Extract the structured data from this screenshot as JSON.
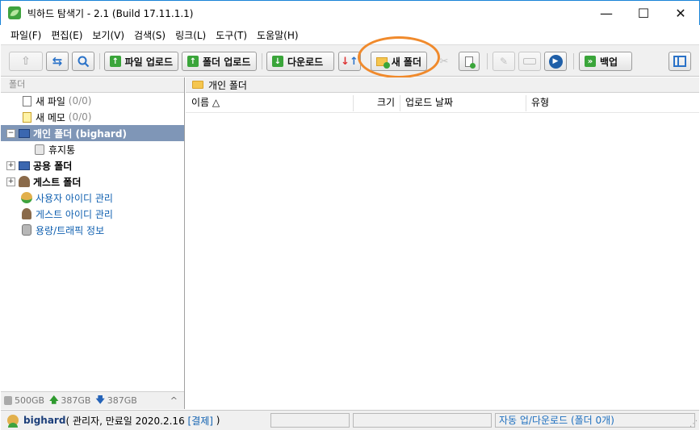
{
  "window": {
    "title": "빅하드 탐색기 - 2.1 (Build 17.11.1.1)",
    "min_glyph": "—",
    "max_glyph": "☐",
    "close_glyph": "✕"
  },
  "menu": [
    "파일(F)",
    "편집(E)",
    "보기(V)",
    "검색(S)",
    "링크(L)",
    "도구(T)",
    "도움말(H)"
  ],
  "toolbar": {
    "file_upload": "파일 업로드",
    "folder_upload": "폴더 업로드",
    "download": "다운로드",
    "new_folder": "새 폴더",
    "backup": "백업",
    "icons": [
      "up-arrow-icon",
      "refresh-icon",
      "search-icon",
      "upload-icon",
      "download-icon",
      "sync-icon",
      "new-folder-icon",
      "cut-icon",
      "new-file-icon",
      "rename-icon",
      "tag-icon",
      "play-icon",
      "backup-icon",
      "panel-toggle-icon"
    ]
  },
  "left_pane": {
    "header": "폴더",
    "tree": [
      {
        "label": "새 파일",
        "count": "(0/0)"
      },
      {
        "label": "새 메모",
        "count": "(0/0)"
      },
      {
        "label": "개인 폴더 (bighard)",
        "selected": true
      },
      {
        "label": "휴지통"
      },
      {
        "label": "공용 폴더"
      },
      {
        "label": "게스트 폴더"
      },
      {
        "label": "사용자 아이디 관리"
      },
      {
        "label": "게스트 아이디 관리"
      },
      {
        "label": "용량/트래픽 정보"
      }
    ],
    "status": {
      "total": "500GB",
      "up": "387GB",
      "down": "387GB",
      "chevron": "^"
    }
  },
  "right_pane": {
    "path": "개인 폴더",
    "columns": {
      "name": "이름 △",
      "size": "크기",
      "date": "업로드 날짜",
      "type": "유형"
    }
  },
  "statusbar": {
    "user": "bighard",
    "info_prefix": "( 관리자, 만료일 2020.2.16 ",
    "pay_link": "[결제]",
    "info_suffix": " )",
    "transfer": "자동 업/다운로드 (폴더 0개)"
  },
  "colors": {
    "accent_border": "#1883d7",
    "highlight": "#f08a2c",
    "selected_row": "#7f96b7",
    "link": "#1060b0"
  }
}
